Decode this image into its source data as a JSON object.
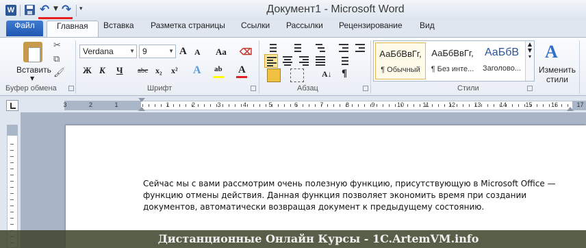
{
  "window": {
    "title": "Документ1 - Microsoft Word",
    "app_letter": "W"
  },
  "tabs": {
    "file": "Файл",
    "items": [
      "Главная",
      "Вставка",
      "Разметка страницы",
      "Ссылки",
      "Рассылки",
      "Рецензирование",
      "Вид"
    ]
  },
  "clipboard": {
    "paste_label": "Вставить",
    "group_label": "Буфер обмена"
  },
  "font": {
    "name": "Verdana",
    "size": "9",
    "group_label": "Шрифт",
    "bold": "Ж",
    "italic": "К",
    "underline": "Ч",
    "strike": "abc",
    "subscript": "x₂",
    "superscript": "x²",
    "case_label": "Aa",
    "grow": "A",
    "shrink": "A",
    "highlight": "ab",
    "font_color": "A"
  },
  "paragraph": {
    "group_label": "Абзац",
    "pilcrow": "¶"
  },
  "styles": {
    "group_label": "Стили",
    "tiles": [
      {
        "sample": "АаБбВвГг,",
        "name": "¶ Обычный"
      },
      {
        "sample": "АаБбВвГг,",
        "name": "¶ Без инте..."
      },
      {
        "sample": "АаБбВ",
        "name": "Заголово..."
      }
    ],
    "change_label": "Изменить стили"
  },
  "ruler": {
    "numbers": [
      "3",
      "2",
      "1",
      "1",
      "2",
      "3",
      "4",
      "5",
      "6",
      "7",
      "8",
      "9",
      "10",
      "11",
      "12",
      "13",
      "14",
      "15",
      "16",
      "17"
    ]
  },
  "document": {
    "text": "Сейчас мы с вами рассмотрим очень полезную функцию, присутствующую в Microsoft Office — функцию отмены действия. Данная функция позволяет экономить время при создании документов, автоматически возвращая документ к предыдущему состоянию."
  },
  "banner": {
    "text": "Дистанционные Онлайн Курсы - 1C.ArtemVM.info"
  },
  "colors": {
    "file_tab": "#2b64c0",
    "highlight_yellow": "#ffff00",
    "font_red": "#e02020",
    "undo_mark": "#e81f1f"
  }
}
